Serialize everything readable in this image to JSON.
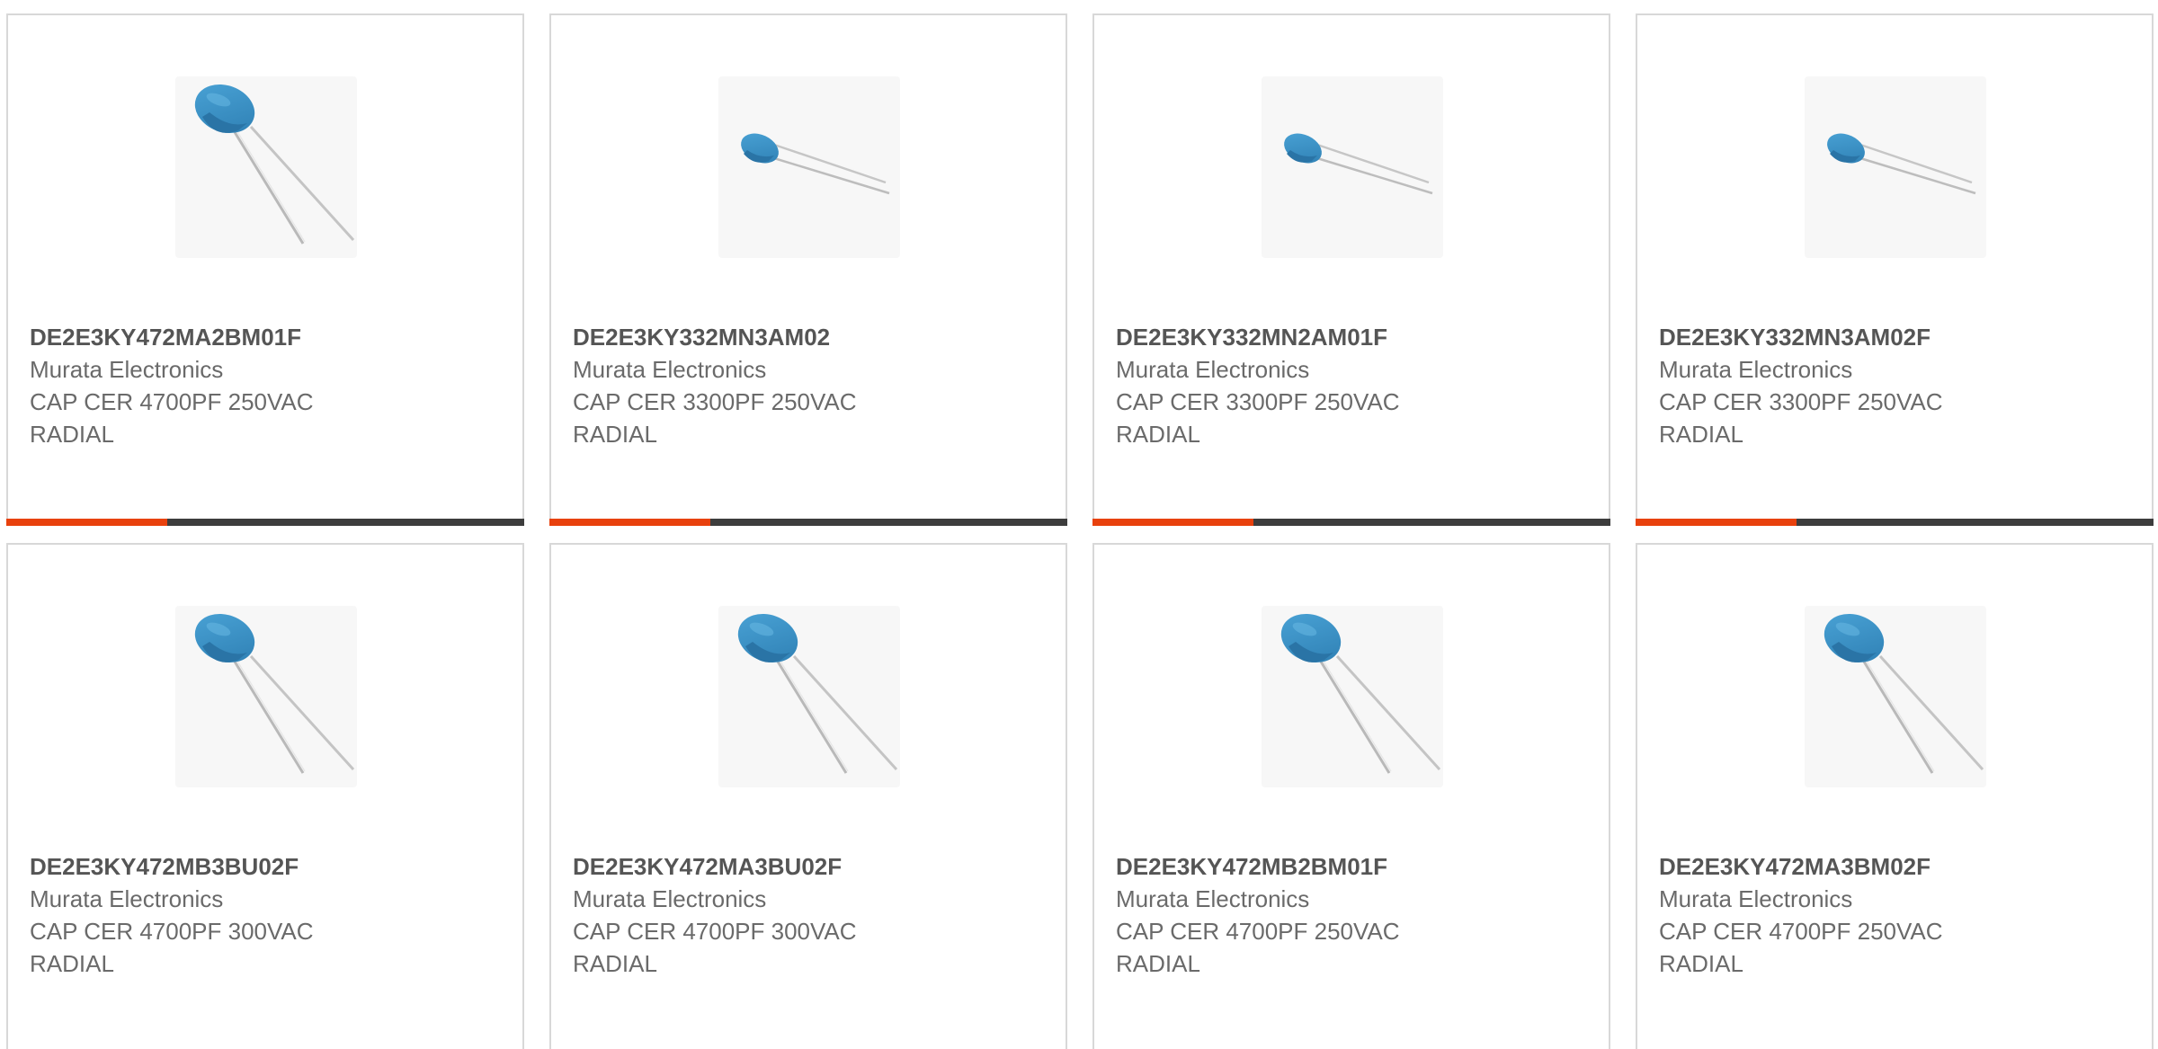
{
  "accent_color": "#e8410d",
  "track_color": "#3d3d3d",
  "products": [
    {
      "part_number": "DE2E3KY472MA2BM01F",
      "manufacturer": "Murata Electronics",
      "description": "CAP CER 4700PF 250VAC RADIAL",
      "image_icon": "ceramic-disc-capacitor-large",
      "progress_fraction": 0.31
    },
    {
      "part_number": "DE2E3KY332MN3AM02",
      "manufacturer": "Murata Electronics",
      "description": "CAP CER 3300PF 250VAC RADIAL",
      "image_icon": "ceramic-disc-capacitor-small",
      "progress_fraction": 0.31
    },
    {
      "part_number": "DE2E3KY332MN2AM01F",
      "manufacturer": "Murata Electronics",
      "description": "CAP CER 3300PF 250VAC RADIAL",
      "image_icon": "ceramic-disc-capacitor-small",
      "progress_fraction": 0.31
    },
    {
      "part_number": "DE2E3KY332MN3AM02F",
      "manufacturer": "Murata Electronics",
      "description": "CAP CER 3300PF 250VAC RADIAL",
      "image_icon": "ceramic-disc-capacitor-small",
      "progress_fraction": 0.31
    },
    {
      "part_number": "DE2E3KY472MB3BU02F",
      "manufacturer": "Murata Electronics",
      "description": "CAP CER 4700PF 300VAC RADIAL",
      "image_icon": "ceramic-disc-capacitor-large"
    },
    {
      "part_number": "DE2E3KY472MA3BU02F",
      "manufacturer": "Murata Electronics",
      "description": "CAP CER 4700PF 300VAC RADIAL",
      "image_icon": "ceramic-disc-capacitor-large"
    },
    {
      "part_number": "DE2E3KY472MB2BM01F",
      "manufacturer": "Murata Electronics",
      "description": "CAP CER 4700PF 250VAC RADIAL",
      "image_icon": "ceramic-disc-capacitor-large"
    },
    {
      "part_number": "DE2E3KY472MA3BM02F",
      "manufacturer": "Murata Electronics",
      "description": "CAP CER 4700PF 250VAC RADIAL",
      "image_icon": "ceramic-disc-capacitor-large"
    }
  ]
}
